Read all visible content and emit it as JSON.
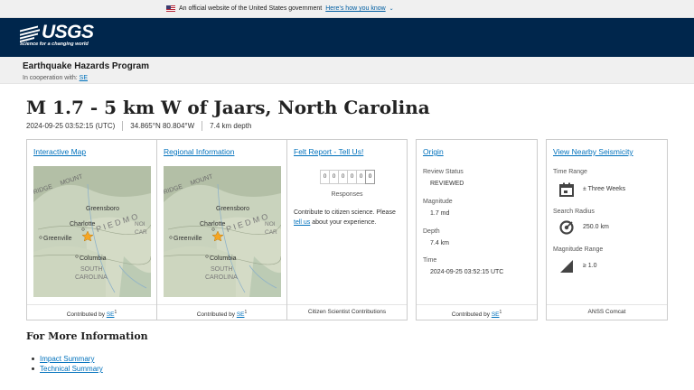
{
  "gov_banner": {
    "text": "An official website of the United States government",
    "link": "Here’s how you know"
  },
  "header": {
    "logo_text": "USGS",
    "logo_tagline": "science for a changing world"
  },
  "program": {
    "title": "Earthquake Hazards Program",
    "cooperation_label": "In cooperation with:",
    "cooperation_network": "SE"
  },
  "event": {
    "title": "M 1.7 - 5 km W of Jaars, North Carolina",
    "time": "2024-09-25 03:52:15 (UTC)",
    "location": "34.865°N 80.804°W",
    "depth": "7.4 km depth"
  },
  "cards": {
    "interactive_map": {
      "title": "Interactive Map",
      "footer_prefix": "Contributed by",
      "footer_network": "SE",
      "footer_sup": "1"
    },
    "regional_info": {
      "title": "Regional Information",
      "footer_prefix": "Contributed by",
      "footer_network": "SE",
      "footer_sup": "1"
    },
    "felt_report": {
      "title": "Felt Report - Tell Us!",
      "response_digits": [
        "0",
        "0",
        "0",
        "0",
        "0",
        "0"
      ],
      "responses_label": "Responses",
      "text_before": "Contribute to citizen science. Please",
      "text_link": "tell us",
      "text_after": "about your experience.",
      "footer": "Citizen Scientist Contributions"
    },
    "origin": {
      "title": "Origin",
      "review_status_label": "Review Status",
      "review_status": "REVIEWED",
      "magnitude_label": "Magnitude",
      "magnitude": "1.7 md",
      "depth_label": "Depth",
      "depth": "7.4 km",
      "time_label": "Time",
      "time": "2024-09-25 03:52:15 UTC",
      "footer_prefix": "Contributed by",
      "footer_network": "SE",
      "footer_sup": "1"
    },
    "seismicity": {
      "title": "View Nearby Seismicity",
      "time_range_label": "Time Range",
      "time_range": "± Three Weeks",
      "search_radius_label": "Search Radius",
      "search_radius": "250.0 km",
      "magnitude_range_label": "Magnitude Range",
      "magnitude_range": "≥ 1.0",
      "footer": "ANSS Comcat"
    }
  },
  "map_labels": {
    "ridge": "RIDGE",
    "mount": "MOUNT",
    "piedmont": "P I E D M O",
    "greensboro": "Greensboro",
    "charlotte": "Charlotte",
    "greenville": "Greenville",
    "columbia": "Columbia",
    "south": "SOUTH",
    "carolina": "CAROLINA",
    "nor": "NOI",
    "car": "CAR"
  },
  "more_info": {
    "title": "For More Information",
    "links": [
      "Impact Summary",
      "Technical Summary"
    ]
  },
  "colors": {
    "header_bg": "#00264c",
    "link": "#0071bc",
    "epicenter_star": "#f5a623"
  }
}
